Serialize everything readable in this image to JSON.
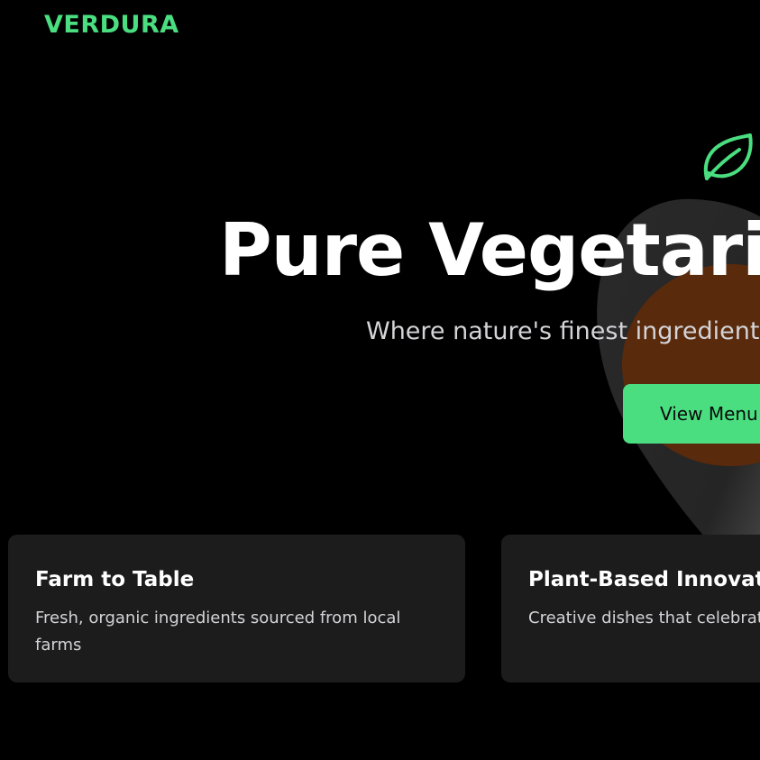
{
  "brand": {
    "name": "VERDURA",
    "accent_color": "#4ade80"
  },
  "hero": {
    "title": "Pure Vegetarian",
    "subtitle": "Where nature's finest ingredients",
    "cta_label": "View Menu",
    "decor_icon": "leaf-icon",
    "illustration": "avocado-illustration"
  },
  "features": [
    {
      "title": "Farm to Table",
      "description": "Fresh, organic ingredients sourced from local farms"
    },
    {
      "title": "Plant-Based Innovation",
      "description": "Creative dishes that celebrate"
    }
  ],
  "colors": {
    "background": "#000000",
    "card_background": "#1c1c1c",
    "avocado_skin": "#262626",
    "avocado_pit": "#5a2a0c"
  }
}
